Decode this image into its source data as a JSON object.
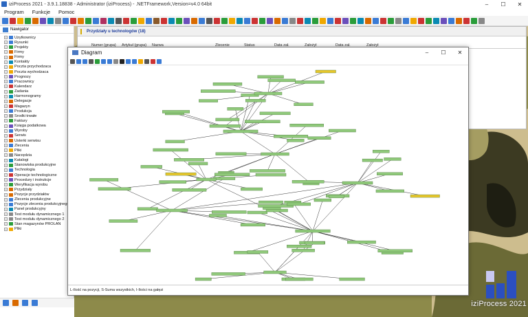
{
  "app": {
    "title": "iziProcess 2021 - 3.9.1.18838 - Administrator (iziProcess) - .NETFramework,Version=v4.0 64bit",
    "window_controls": [
      "–",
      "☐",
      "✕"
    ]
  },
  "menu": [
    "Program",
    "Funkcje",
    "Pomoc"
  ],
  "toolbar_colors": [
    "#3a7bd5",
    "#c33",
    "#f0a800",
    "#2a9d3a",
    "#d96a00",
    "#6b4fbb",
    "#0a8ab3",
    "#888",
    "#3a7bd5",
    "#c33",
    "#e07b00",
    "#2a9d3a",
    "#3a7bd5",
    "#b03060",
    "#0a8ab3",
    "#555",
    "#c33",
    "#2a9d3a",
    "#f0a800",
    "#3a7bd5",
    "#8a5a2b",
    "#c33",
    "#0a8ab3",
    "#2a9d3a",
    "#6b4fbb",
    "#d96a00",
    "#3a7bd5",
    "#555",
    "#c33",
    "#2a9d3a",
    "#f0a800",
    "#0a8ab3",
    "#3a7bd5",
    "#c33",
    "#2a9d3a",
    "#6b4fbb",
    "#d96a00",
    "#3a7bd5",
    "#888",
    "#c33",
    "#0a8ab3",
    "#2a9d3a",
    "#f0a800",
    "#3a7bd5",
    "#c33",
    "#6b4fbb",
    "#2a9d3a",
    "#0a8ab3",
    "#d96a00",
    "#3a7bd5",
    "#c33",
    "#2a9d3a",
    "#888",
    "#3a7bd5",
    "#f0a800",
    "#c33",
    "#2a9d3a",
    "#0a8ab3",
    "#6b4fbb",
    "#3a7bd5",
    "#d96a00",
    "#c33",
    "#2a9d3a",
    "#888"
  ],
  "navigator": {
    "title": "Nawigator",
    "items": [
      {
        "label": "Uzytkownicy",
        "color": "#3a7bd5"
      },
      {
        "label": "Rysunki",
        "color": "#3a7bd5"
      },
      {
        "label": "Projekty",
        "color": "#2a9d3a"
      },
      {
        "label": "Firmy",
        "color": "#d96a00"
      },
      {
        "label": "Firmy",
        "color": "#d96a00"
      },
      {
        "label": "Kontakty",
        "color": "#0a8ab3"
      },
      {
        "label": "Poczta przychodzaca",
        "color": "#f0a800"
      },
      {
        "label": "Poczta wychodzaca",
        "color": "#f0a800"
      },
      {
        "label": "Prognozy",
        "color": "#6b4fbb"
      },
      {
        "label": "Pracownicy",
        "color": "#3a7bd5"
      },
      {
        "label": "Kalendarz",
        "color": "#c33"
      },
      {
        "label": "Zadania",
        "color": "#2a9d3a"
      },
      {
        "label": "Harmonogramy",
        "color": "#0a8ab3"
      },
      {
        "label": "Delegacje",
        "color": "#d96a00"
      },
      {
        "label": "Magazyn",
        "color": "#c33"
      },
      {
        "label": "Produkcja",
        "color": "#3a7bd5"
      },
      {
        "label": "Srodki trwałe",
        "color": "#888"
      },
      {
        "label": "Faktury",
        "color": "#2a9d3a"
      },
      {
        "label": "Księga podatkowa",
        "color": "#6b4fbb"
      },
      {
        "label": "Wyroby",
        "color": "#3a7bd5"
      },
      {
        "label": "Serwis",
        "color": "#c33"
      },
      {
        "label": "Usterki serwisu",
        "color": "#d96a00"
      },
      {
        "label": "Zlecenia",
        "color": "#3a7bd5"
      },
      {
        "label": "Pliki",
        "color": "#f0a800"
      },
      {
        "label": "Narzędzia",
        "color": "#888"
      },
      {
        "label": "Katalogi",
        "color": "#0a8ab3"
      },
      {
        "label": "Stanowiska produkcyjne",
        "color": "#2a9d3a"
      },
      {
        "label": "Technologia",
        "color": "#3a7bd5"
      },
      {
        "label": "Operacje technologiczne",
        "color": "#c33"
      },
      {
        "label": "Procedury i instrukcje",
        "color": "#6b4fbb"
      },
      {
        "label": "Weryfikacja wyrobu",
        "color": "#2a9d3a"
      },
      {
        "label": "Przydziały",
        "color": "#d96a00"
      },
      {
        "label": "Pozycje przydziałów",
        "color": "#d96a00"
      },
      {
        "label": "Zlecenia produkcyjne",
        "color": "#3a7bd5"
      },
      {
        "label": "Pozycje zlecenia produkcyjnego",
        "color": "#3a7bd5"
      },
      {
        "label": "Panel produkcyjny",
        "color": "#0a8ab3"
      },
      {
        "label": "Test modułu dynamicznego 1",
        "color": "#888"
      },
      {
        "label": "Test modułu dynamicznego 2",
        "color": "#888"
      },
      {
        "label": "Stan magazynów PROLAN",
        "color": "#2a9d3a"
      },
      {
        "label": "Pliki",
        "color": "#f0a800"
      }
    ]
  },
  "bottom_tools": [
    "#3a7bd5",
    "#d96a00",
    "#3a7bd5",
    "#3a7bd5"
  ],
  "background_window": {
    "title": "Przydziały u technologów (18)",
    "columns": [
      "Numer (grupa)",
      "Artykuł (grupa)",
      "Nazwa",
      "Zlecenie",
      "Status",
      "Data zał.",
      "Założył",
      "Data zał.",
      "Założył"
    ]
  },
  "diagram": {
    "title": "Diagram",
    "window_controls": [
      "–",
      "☐",
      "✕"
    ],
    "toolbar_colors": [
      "#555",
      "#3a7bd5",
      "#3a7bd5",
      "#555",
      "#2a9d3a",
      "#3a7bd5",
      "#3a7bd5",
      "#888",
      "#222",
      "#3a7bd5",
      "#3a7bd5",
      "#f0a800",
      "#555",
      "#c33",
      "#3a7bd5"
    ],
    "status": "L-Ilość na pozycji, S-Suma wszystkich, I-Ilości na gałęzi"
  },
  "brand": {
    "text": "iziProcess 2021"
  }
}
